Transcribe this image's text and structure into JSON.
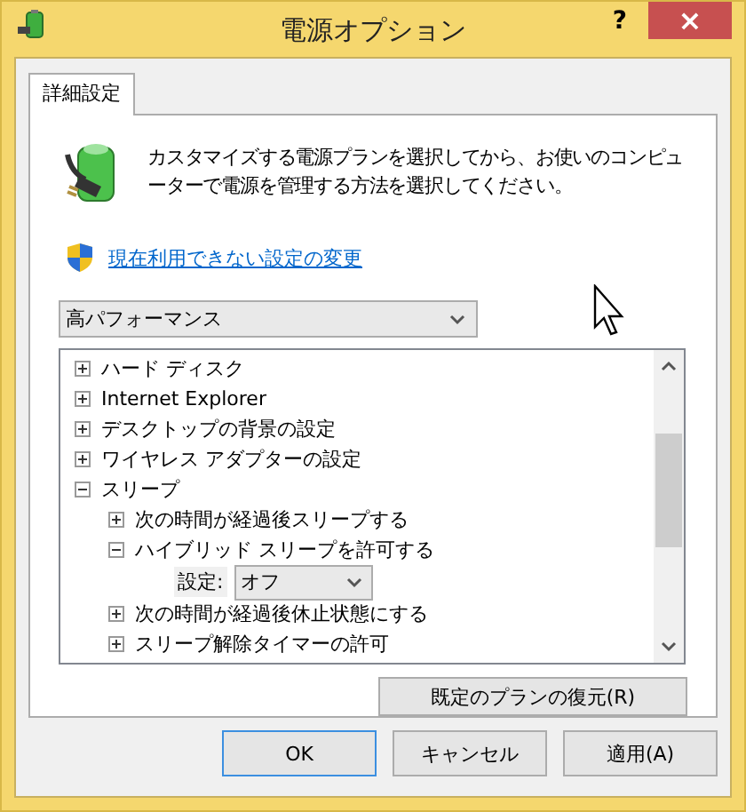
{
  "window": {
    "title": "電源オプション",
    "help": "?",
    "close": "×"
  },
  "tabs": [
    {
      "label": "詳細設定",
      "selected": true
    }
  ],
  "description": "カスタマイズする電源プランを選択してから、お使いのコンピューターで電源を管理する方法を選択してください。",
  "link": "現在利用できない設定の変更",
  "plan_dropdown": {
    "value": "高パフォーマンス"
  },
  "tree": [
    {
      "label": "ハード ディスク",
      "expanded": false
    },
    {
      "label": "Internet Explorer",
      "expanded": false
    },
    {
      "label": "デスクトップの背景の設定",
      "expanded": false
    },
    {
      "label": "ワイヤレス アダプターの設定",
      "expanded": false
    },
    {
      "label": "スリープ",
      "expanded": true,
      "children": [
        {
          "label": "次の時間が経過後スリープする",
          "expanded": false
        },
        {
          "label": "ハイブリッド スリープを許可する",
          "expanded": true,
          "setting": {
            "label": "設定:",
            "value": "オフ"
          }
        },
        {
          "label": "次の時間が経過後休止状態にする",
          "expanded": false
        },
        {
          "label": "スリープ解除タイマーの許可",
          "expanded": false
        }
      ]
    }
  ],
  "restore_button": "既定のプランの復元(R)",
  "buttons": [
    {
      "label": "OK",
      "default": true
    },
    {
      "label": "キャンセル",
      "default": false
    },
    {
      "label": "適用(A)",
      "default": false
    }
  ]
}
